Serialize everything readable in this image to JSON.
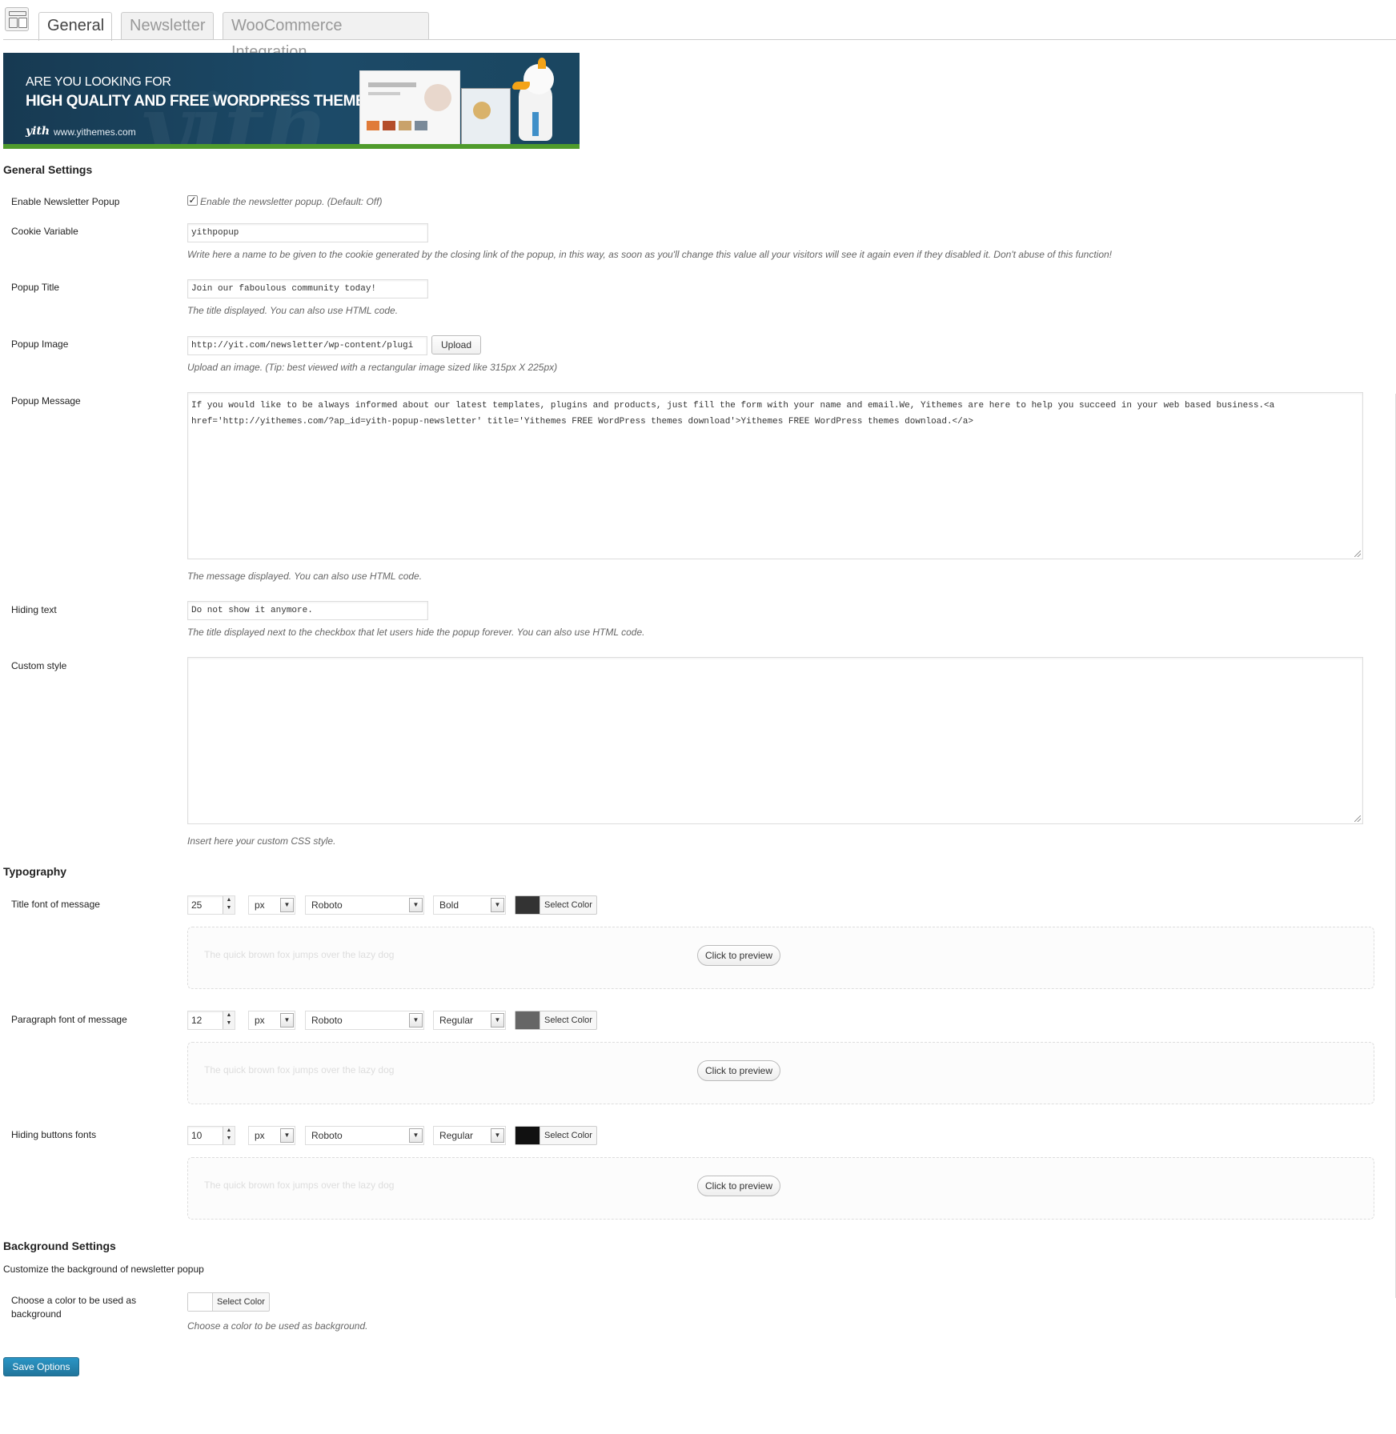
{
  "tabs": [
    {
      "label": "General",
      "active": true
    },
    {
      "label": "Newsletter",
      "active": false
    },
    {
      "label": "WooCommerce Integration",
      "active": false
    }
  ],
  "banner": {
    "line1": "ARE YOU LOOKING FOR",
    "line2": "HIGH QUALITY AND FREE WORDPRESS THEMES?",
    "logo": "yith",
    "url": "www.yithemes.com",
    "watermark": "yith"
  },
  "general": {
    "heading": "General Settings",
    "enable_popup": {
      "label": "Enable Newsletter Popup",
      "checked": true,
      "desc": "Enable the newsletter popup. (Default: Off)"
    },
    "cookie": {
      "label": "Cookie Variable",
      "value": "yithpopup",
      "desc": "Write here a name to be given to the cookie generated by the closing link of the popup, in this way, as soon as you'll change this value all your visitors will see it again even if they disabled it. Don't abuse of this function!"
    },
    "popup_title": {
      "label": "Popup Title",
      "value": "Join our faboulous community today!",
      "desc": "The title displayed. You can also use HTML code."
    },
    "popup_image": {
      "label": "Popup Image",
      "value": "http://yit.com/newsletter/wp-content/plugi",
      "upload_label": "Upload",
      "desc": "Upload an image. (Tip: best viewed with a rectangular image sized like 315px X 225px)"
    },
    "popup_message": {
      "label": "Popup Message",
      "value": "If you would like to be always informed about our latest templates, plugins and products, just fill the form with your name and email.We, Yithemes are here to help you succeed in your web based business.<a href='http://yithemes.com/?ap_id=yith-popup-newsletter' title='Yithemes FREE  WordPress themes download'>Yithemes FREE  WordPress themes download.</a>",
      "desc": "The message displayed. You can also use HTML code."
    },
    "hiding_text": {
      "label": "Hiding text",
      "value": "Do not show it anymore.",
      "desc": "The title displayed next to the checkbox that let users hide the popup forever. You can also use HTML code."
    },
    "custom_style": {
      "label": "Custom style",
      "value": "",
      "desc": "Insert here your custom CSS style."
    }
  },
  "typography": {
    "heading": "Typography",
    "preview_text": "The quick brown fox jumps over the lazy dog",
    "preview_button": "Click to preview",
    "select_color_label": "Select Color",
    "rows": [
      {
        "label": "Title font of message",
        "size": "25",
        "unit": "px",
        "family": "Roboto",
        "weight": "Bold",
        "color": "#333333"
      },
      {
        "label": "Paragraph font of message",
        "size": "12",
        "unit": "px",
        "family": "Roboto",
        "weight": "Regular",
        "color": "#666666"
      },
      {
        "label": "Hiding buttons fonts",
        "size": "10",
        "unit": "px",
        "family": "Roboto",
        "weight": "Regular",
        "color": "#111111"
      }
    ]
  },
  "background": {
    "heading": "Background Settings",
    "subheading": "Customize the background of newsletter popup",
    "label": "Choose a color to be used as background",
    "select_color_label": "Select Color",
    "color": "#ffffff",
    "desc": "Choose a color to be used as background."
  },
  "save_label": "Save Options",
  "colors": {
    "banner": "#1c4a68",
    "banner_strip": "#4f9b2c",
    "primary_button": "#21759b"
  }
}
